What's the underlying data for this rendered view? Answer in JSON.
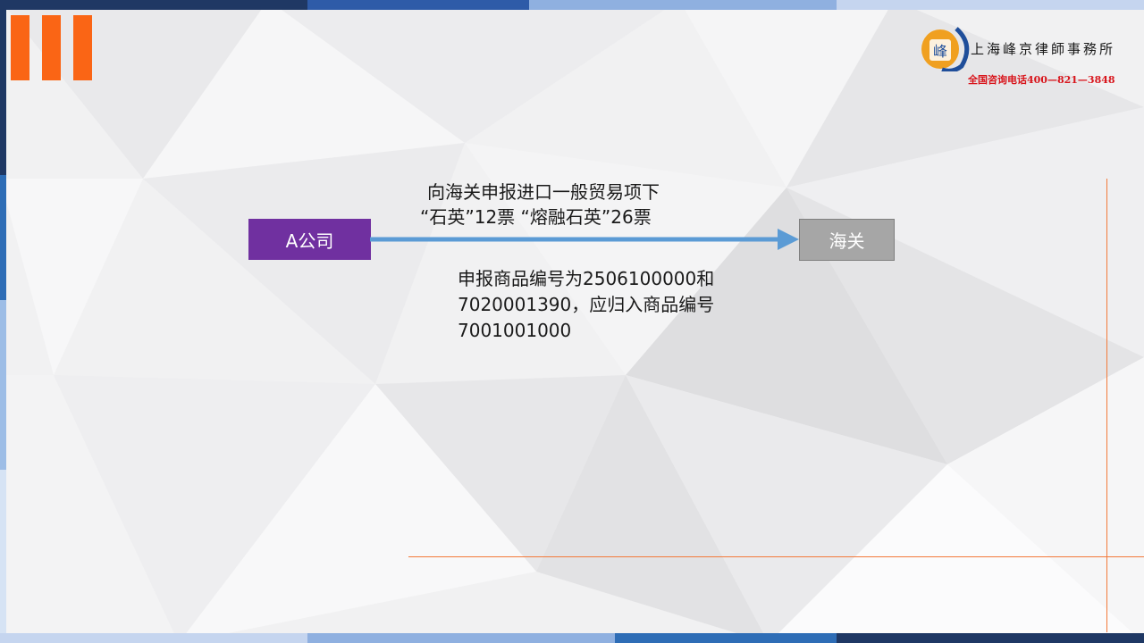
{
  "colors": {
    "accent_orange": "#fa6515",
    "purple_box": "#7030a0",
    "gray_box": "#a6a6a6",
    "arrow_blue": "#5b9bd5",
    "logo_red": "#d8141b",
    "deco_line": "#f37a3a"
  },
  "logo": {
    "name": "上海峰京律師事務所",
    "phone": "全国咨询电话400—821—3848",
    "mark_text": "峰",
    "icon": "law-firm-logo-icon"
  },
  "diagram": {
    "source_box": "A公司",
    "target_box": "海关",
    "arrow_label_line1": "向海关申报进口一般贸易项下",
    "arrow_label_line2": "“石英”12票 “熔融石英”26票",
    "note_line1": "申报商品编号为2506100000和",
    "note_line2": "7020001390，应归入商品编号",
    "note_line3": "7001001000"
  }
}
